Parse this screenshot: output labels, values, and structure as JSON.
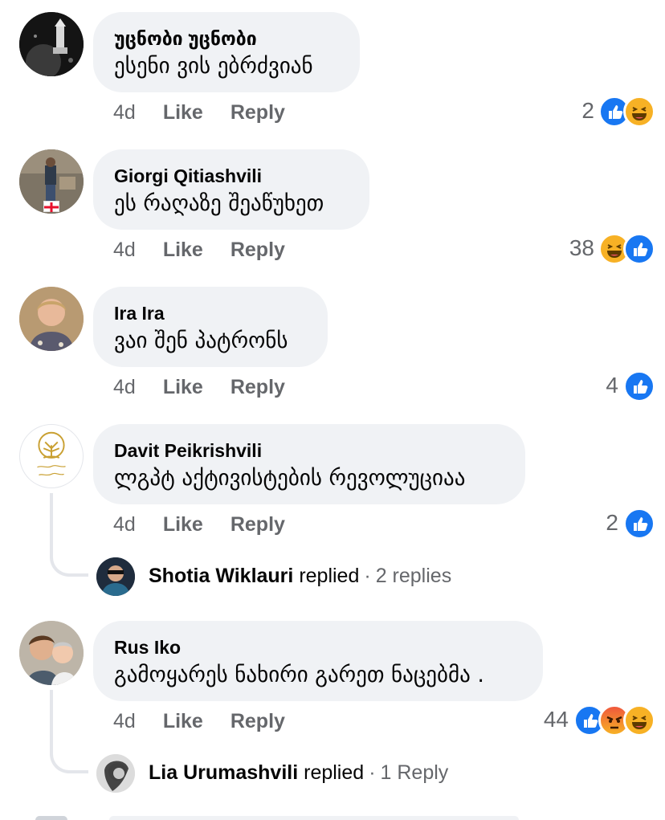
{
  "comments": [
    {
      "author": "უცნობი უცნობი",
      "text": "ესენი ვის ებრძვიან",
      "time": "4d",
      "like_label": "Like",
      "reply_label": "Reply",
      "reaction_count": "2",
      "reactions": [
        "like-icon",
        "haha-icon"
      ]
    },
    {
      "author": "Giorgi Qitiashvili",
      "text": "ეს რაღაზე შეაწუხეთ",
      "time": "4d",
      "like_label": "Like",
      "reply_label": "Reply",
      "reaction_count": "38",
      "reactions": [
        "haha-icon",
        "like-icon"
      ]
    },
    {
      "author": "Ira Ira",
      "text": "ვაი შენ პატრონს",
      "time": "4d",
      "like_label": "Like",
      "reply_label": "Reply",
      "reaction_count": "4",
      "reactions": [
        "like-icon"
      ]
    },
    {
      "author": "Davit Peikrishvili",
      "text": "ლგპტ აქტივისტების რევოლუციაა",
      "time": "4d",
      "like_label": "Like",
      "reply_label": "Reply",
      "reaction_count": "2",
      "reactions": [
        "like-icon"
      ],
      "replies": {
        "name": "Shotia Wiklauri",
        "verb": "replied",
        "separator": "·",
        "count": "2 replies"
      }
    },
    {
      "author": "Rus Iko",
      "text": "გამოყარეს ნახირი გარეთ ნაცებმა .",
      "time": "4d",
      "like_label": "Like",
      "reply_label": "Reply",
      "reaction_count": "44",
      "reactions": [
        "like-icon",
        "angry-icon",
        "haha-icon"
      ],
      "replies": {
        "name": "Lia Urumashvili",
        "verb": "replied",
        "separator": "·",
        "count": "1 Reply"
      }
    }
  ],
  "colors": {
    "bubble": "#f0f2f5",
    "meta_text": "#65676b",
    "like_blue": "#1877f2",
    "haha_yellow": "#f7b125",
    "thread_line": "#e4e6eb"
  }
}
